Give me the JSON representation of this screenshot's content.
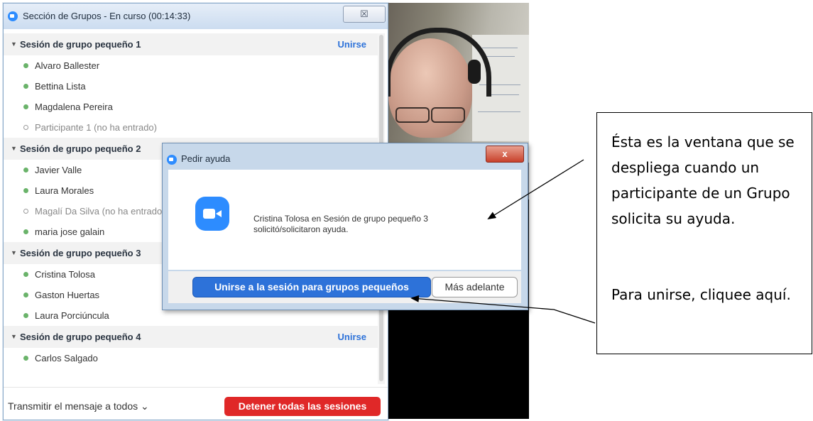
{
  "breakout_window": {
    "title": "Sección de Grupos - En curso (00:14:33)",
    "close_label": "☒",
    "groups": [
      {
        "name": "Sesión de grupo pequeño 1",
        "join_label": "Unirse",
        "participants": [
          {
            "name": "Alvaro Ballester",
            "status": "joined"
          },
          {
            "name": "Bettina Lista",
            "status": "joined"
          },
          {
            "name": "Magdalena Pereira",
            "status": "joined"
          },
          {
            "name": "Participante 1 (no ha entrado)",
            "status": "not-joined"
          }
        ]
      },
      {
        "name": "Sesión de grupo pequeño 2",
        "join_label": "",
        "participants": [
          {
            "name": "Javier Valle",
            "status": "joined"
          },
          {
            "name": "Laura Morales",
            "status": "joined"
          },
          {
            "name": "Magalí Da Silva (no ha entrado)",
            "status": "not-joined"
          },
          {
            "name": "maria jose galain",
            "status": "joined"
          }
        ]
      },
      {
        "name": "Sesión de grupo pequeño 3",
        "join_label": "",
        "participants": [
          {
            "name": "Cristina Tolosa",
            "status": "joined"
          },
          {
            "name": "Gaston Huertas",
            "status": "joined"
          },
          {
            "name": "Laura Porciúncula",
            "status": "joined"
          }
        ]
      },
      {
        "name": "Sesión de grupo pequeño 4",
        "join_label": "Unirse",
        "participants": [
          {
            "name": "Carlos Salgado",
            "status": "joined"
          }
        ]
      }
    ],
    "broadcast_label": "Transmitir el mensaje a todos ⌄",
    "stop_label": "Detener todas las sesiones"
  },
  "help_dialog": {
    "title": "Pedir ayuda",
    "close_label": "x",
    "message": "Cristina Tolosa en Sesión de grupo pequeño 3 solicitó/solicitaron ayuda.",
    "join_label": "Unirse a la sesión para grupos pequeños",
    "later_label": "Más adelante"
  },
  "callout": {
    "paragraph1": "Ésta es la ventana que se despliega cuando un participante de un Grupo solicita su ayuda.",
    "paragraph2": "Para unirse, cliquee aquí."
  },
  "colors": {
    "accent_blue": "#2d72d9",
    "zoom_blue": "#2d8cff",
    "stop_red": "#e02828",
    "joined_dot": "#6ab36a"
  }
}
